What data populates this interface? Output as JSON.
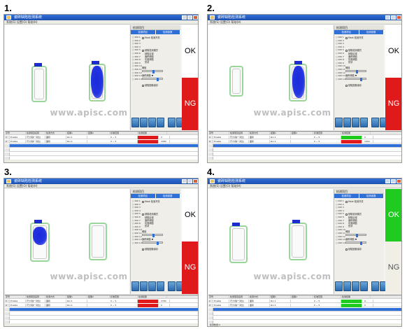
{
  "labels": [
    "1.",
    "2.",
    "3.",
    "4."
  ],
  "colors": {
    "ok_green": "#1ecb1e",
    "ng_red": "#e01a1a",
    "title_blue": "#2f6fd8",
    "defect_blue": "#1a2bd9"
  },
  "app": {
    "title": "瓷砖缺陷检测系统",
    "menu": "系统(S)  设置(O)  帮助(H)",
    "watermark": "www.apisc.com",
    "panel_header": "检测项目",
    "tabs": [
      "检测项目",
      "检测参数"
    ],
    "roi_items": [
      "ROI 1",
      "ROI 2",
      "ROI 3",
      "ROI 4",
      "ROI 5",
      "ROI 6",
      "ROI 7",
      "ROI 8",
      "ROI 9",
      "ROI 10",
      "ROI 11",
      "ROI 12",
      "ROI 13",
      "ROI 14"
    ],
    "opt_main": "Mark 检测开关",
    "opt_group": "缺陷检测模式",
    "opt_sub": [
      "缺陷区域",
      "面积阈值",
      "灰度阈值",
      "形状"
    ],
    "opt_threshold_label": "阈值",
    "opt_area_label": "面积阈值 ▼",
    "opt_save": "缺陷图像保存",
    "result_ok": "OK",
    "result_ng": "NG",
    "grid_headers": [
      "序号",
      "检测项目名称",
      "检测方式",
      "结果1",
      "结果2",
      "标准范围",
      "检测结果"
    ]
  },
  "shots": [
    {
      "label": "1.",
      "rows": [
        {
          "no": "1",
          "name": "Enable",
          "item": "尺寸(缺一对比)",
          "mode": "面积",
          "r1": "Roi 1",
          "range": "0 ~ 5",
          "bar": "red",
          "val": "2"
        },
        {
          "no": "2",
          "name": "Enable",
          "item": "尺寸(缺一对比)",
          "mode": "面积",
          "r1": "Roi 2",
          "range": "0 ~ 5",
          "bar": "red",
          "val": "3380"
        }
      ],
      "ok_active": false,
      "ng_active": true
    },
    {
      "label": "2.",
      "rows": [
        {
          "no": "1",
          "name": "Enable",
          "item": "尺寸(缺一对比)",
          "mode": "面积",
          "r1": "Roi 1",
          "range": "0 ~ 5",
          "bar": "green",
          "val": "0"
        },
        {
          "no": "2",
          "name": "Enable",
          "item": "尺寸(缺一对比)",
          "mode": "面积",
          "r1": "Roi 2",
          "range": "0 ~ 5",
          "bar": "red",
          "val": "1950"
        }
      ],
      "ok_active": false,
      "ng_active": true
    },
    {
      "label": "3.",
      "rows": [
        {
          "no": "1",
          "name": "Enable",
          "item": "尺寸(缺一对比)",
          "mode": "面积",
          "r1": "Roi 1",
          "range": "0 ~ 5",
          "bar": "red",
          "val": "2780"
        },
        {
          "no": "2",
          "name": "Enable",
          "item": "尺寸(缺一对比)",
          "mode": "面积",
          "r1": "Roi 2",
          "range": "0 ~ 5",
          "bar": "red",
          "val": "2"
        }
      ],
      "ok_active": false,
      "ng_active": true
    },
    {
      "label": "4.",
      "rows": [
        {
          "no": "1",
          "name": "Enable",
          "item": "尺寸(缺一对比)",
          "mode": "面积",
          "r1": "Roi 1",
          "range": "0 ~ 5",
          "bar": "green",
          "val": "0"
        },
        {
          "no": "2",
          "name": "Enable",
          "item": "尺寸(缺一对比)",
          "mode": "面积",
          "r1": "Roi 2",
          "range": "0 ~ 5",
          "bar": "green",
          "val": "0"
        }
      ],
      "ok_active": true,
      "ng_active": false
    }
  ],
  "status_text": "检测数量:0",
  "icons": [
    "app-icon",
    "minimize-icon",
    "maximize-icon",
    "close-icon",
    "toolbar-button-icon"
  ]
}
